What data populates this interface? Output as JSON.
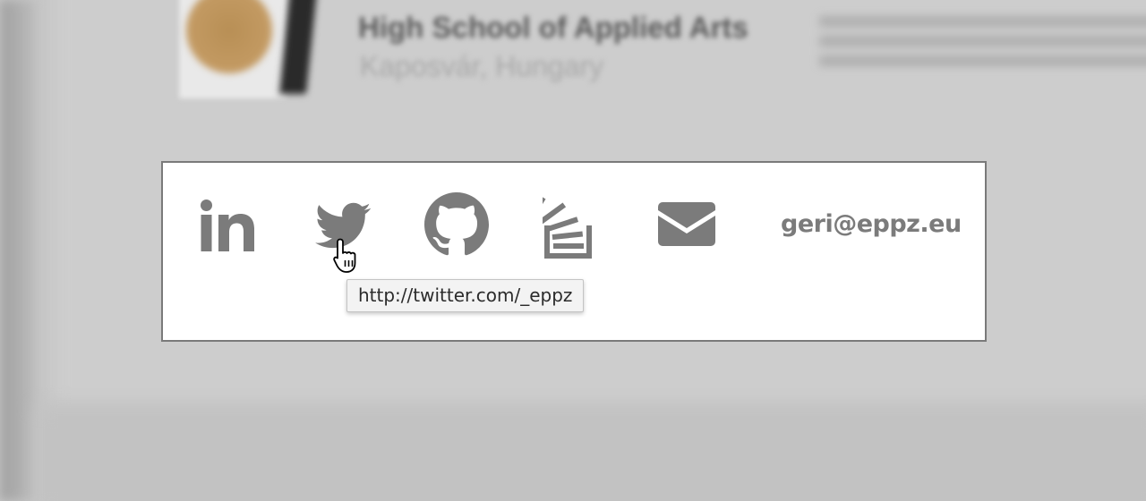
{
  "background": {
    "school_name": "High School of Applied Arts",
    "location": "Kaposvár, Hungary"
  },
  "social_links": [
    {
      "name": "LinkedIn",
      "icon": "linkedin-icon"
    },
    {
      "name": "Twitter",
      "icon": "twitter-icon",
      "hovered": true
    },
    {
      "name": "GitHub",
      "icon": "github-icon"
    },
    {
      "name": "Stack Overflow",
      "icon": "stackoverflow-icon"
    },
    {
      "name": "Email",
      "icon": "envelope-icon"
    }
  ],
  "email": "geri@eppz.eu",
  "tooltip": {
    "text": "http://twitter.com/_eppz"
  },
  "colors": {
    "icon": "#7b7b7b",
    "panel_border": "#7a7a7a",
    "backdrop": "#c7c7c7"
  }
}
